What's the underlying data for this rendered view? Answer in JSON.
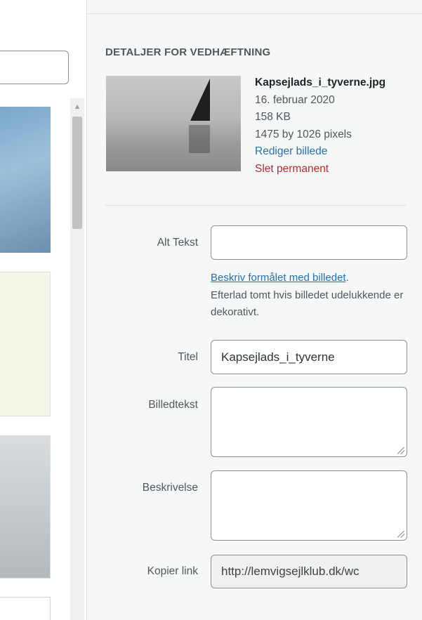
{
  "details": {
    "heading": "DETALJER FOR VEDHÆFTNING",
    "filename": "Kapsejlads_i_tyverne.jpg",
    "date": "16. februar 2020",
    "filesize": "158 KB",
    "dimensions": "1475 by 1026 pixels",
    "edit_link": "Rediger billede",
    "delete_link": "Slet permanent"
  },
  "form": {
    "alt_label": "Alt Tekst",
    "alt_value": "",
    "help_link": "Beskriv formålet med billedet",
    "help_period": ".",
    "help_text": "Efterlad tomt hvis billedet udelukkende er dekorativt.",
    "title_label": "Titel",
    "title_value": "Kapsejlads_i_tyverne",
    "caption_label": "Billedtekst",
    "caption_value": "",
    "description_label": "Beskrivelse",
    "description_value": "",
    "copy_label": "Kopier link",
    "copy_value": "http://lemvigsejlklub.dk/wc"
  },
  "colors": {
    "link": "#2271b1",
    "delete": "#b32d2e"
  },
  "icons": {
    "scroll_up": "▲"
  }
}
